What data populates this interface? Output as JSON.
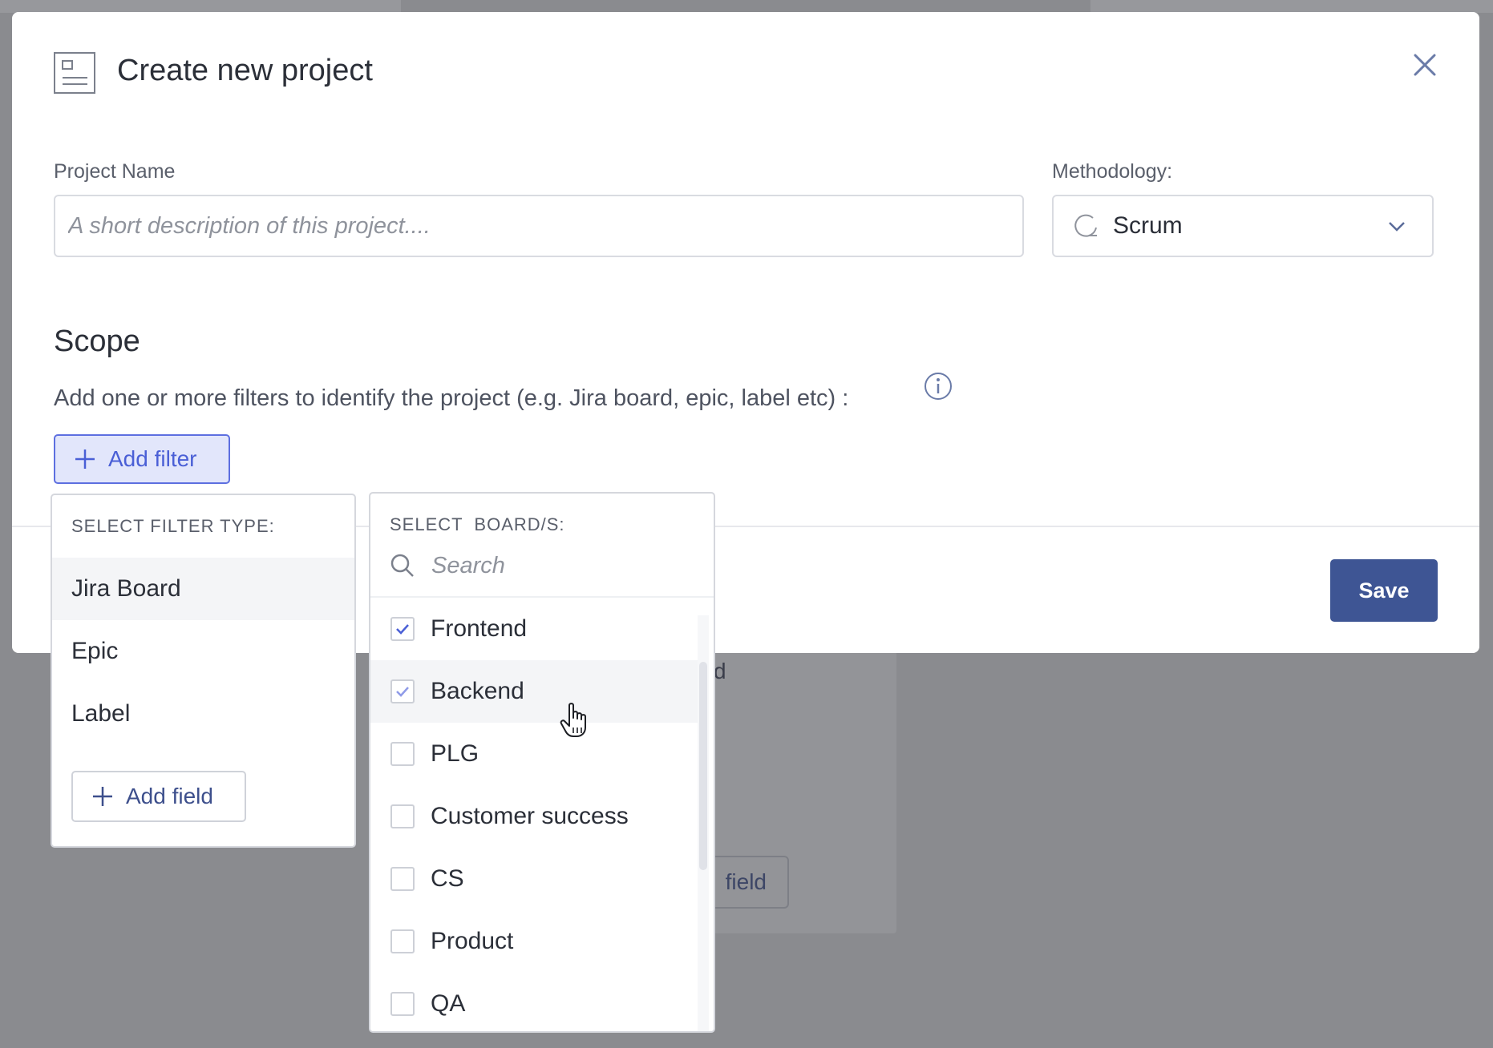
{
  "modal": {
    "title": "Create new project",
    "project_name_label": "Project Name",
    "project_name_placeholder": "A short description of this project....",
    "methodology_label": "Methodology:",
    "methodology_value": "Scrum",
    "scope_title": "Scope",
    "scope_description": "Add one or more filters to identify the project (e.g. Jira board, epic, label etc) :",
    "add_filter_label": "Add filter",
    "save_label": "Save"
  },
  "filter_type_menu": {
    "header": "SELECT FILTER TYPE:",
    "items": [
      {
        "label": "Jira Board",
        "active": true
      },
      {
        "label": "Epic",
        "active": false
      },
      {
        "label": "Label",
        "active": false
      }
    ],
    "add_field_label": "Add field"
  },
  "board_menu": {
    "header": "SELECT  BOARD/S:",
    "search_placeholder": "Search",
    "items": [
      {
        "label": "Frontend",
        "checked": true
      },
      {
        "label": "Backend",
        "checked": true
      },
      {
        "label": "PLG",
        "checked": false
      },
      {
        "label": "Customer success",
        "checked": false
      },
      {
        "label": "CS",
        "checked": false
      },
      {
        "label": "Product",
        "checked": false
      },
      {
        "label": "QA",
        "checked": false
      }
    ]
  },
  "background": {
    "partial_text_1": "d",
    "partial_text_2": "field"
  },
  "colors": {
    "accent": "#4a5fd6",
    "save_button": "#3e5594",
    "check_primary": "#4a5fd6",
    "check_secondary": "#8f9be8"
  }
}
